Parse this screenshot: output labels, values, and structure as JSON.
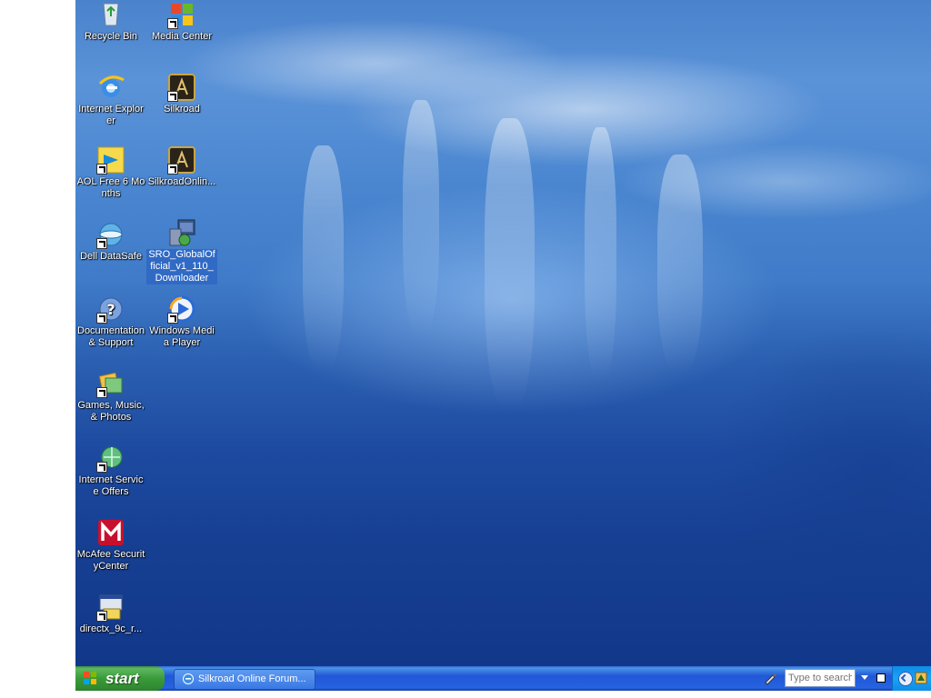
{
  "desktop": {
    "icons": [
      {
        "label": "Recycle Bin",
        "icon": "recycle-bin-icon"
      },
      {
        "label": "Media Center",
        "icon": "windows-flag-icon"
      },
      {
        "label": "Internet Explorer",
        "icon": "internet-explorer-icon"
      },
      {
        "label": "Silkroad",
        "icon": "silkroad-icon"
      },
      {
        "label": "AOL Free 6 Months",
        "icon": "aol-icon"
      },
      {
        "label": "SilkroadOnlin...",
        "icon": "silkroad-icon"
      },
      {
        "label": "Dell DataSafe",
        "icon": "dell-datasafe-icon"
      },
      {
        "label": "SRO_GlobalOfficial_v1_110_Downloader",
        "icon": "installer-icon"
      },
      {
        "label": "Documentation & Support",
        "icon": "help-icon"
      },
      {
        "label": "Windows Media Player",
        "icon": "media-player-icon"
      },
      {
        "label": "Games, Music, & Photos",
        "icon": "games-music-photos-icon"
      },
      {
        "label": "Internet Service Offers",
        "icon": "internet-offers-icon"
      },
      {
        "label": "McAfee SecurityCenter",
        "icon": "mcafee-icon"
      },
      {
        "label": "directx_9c_r...",
        "icon": "setup-icon"
      }
    ]
  },
  "taskbar": {
    "start_label": "start",
    "task_button": "Silkroad Online Forum...",
    "search_placeholder": "Type to search"
  },
  "colors": {
    "taskbar": "#2157d7",
    "start_button": "#3a9a3a",
    "selection": "#316ac5"
  }
}
